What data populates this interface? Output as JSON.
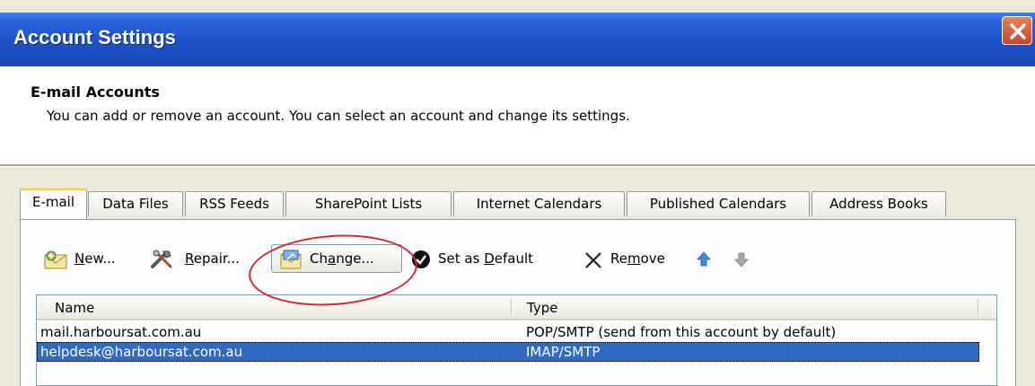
{
  "window": {
    "title": "Account Settings"
  },
  "header": {
    "title": "E-mail Accounts",
    "description": "You can add or remove an account. You can select an account and change its settings."
  },
  "tabs": [
    {
      "label": "E-mail",
      "active": true
    },
    {
      "label": "Data Files"
    },
    {
      "label": "RSS Feeds"
    },
    {
      "label": "SharePoint Lists"
    },
    {
      "label": "Internet Calendars"
    },
    {
      "label": "Published Calendars"
    },
    {
      "label": "Address Books"
    }
  ],
  "toolbar": {
    "new_pre": "",
    "new_key": "N",
    "new_post": "ew...",
    "repair_pre": "",
    "repair_key": "R",
    "repair_post": "epair...",
    "change_pre": "Ch",
    "change_key": "a",
    "change_post": "nge...",
    "default_pre": "Set as ",
    "default_key": "D",
    "default_post": "efault",
    "remove_pre": "Re",
    "remove_key": "m",
    "remove_post": "ove"
  },
  "list": {
    "columns": [
      "Name",
      "Type"
    ],
    "rows": [
      {
        "name": "mail.harboursat.com.au",
        "type": "POP/SMTP (send from this account by default)",
        "selected": false
      },
      {
        "name": "helpdesk@harboursat.com.au",
        "type": "IMAP/SMTP",
        "selected": true
      }
    ]
  },
  "colors": {
    "title_bar": "#1e51c8",
    "selection": "#316ac5",
    "annotation": "#d42a2a",
    "tab_highlight": "#ffc83c"
  },
  "icons": [
    "close-icon",
    "new-account-icon",
    "repair-tools-icon",
    "change-settings-icon",
    "check-default-icon",
    "remove-x-icon",
    "move-up-arrow-icon",
    "move-down-arrow-icon"
  ]
}
